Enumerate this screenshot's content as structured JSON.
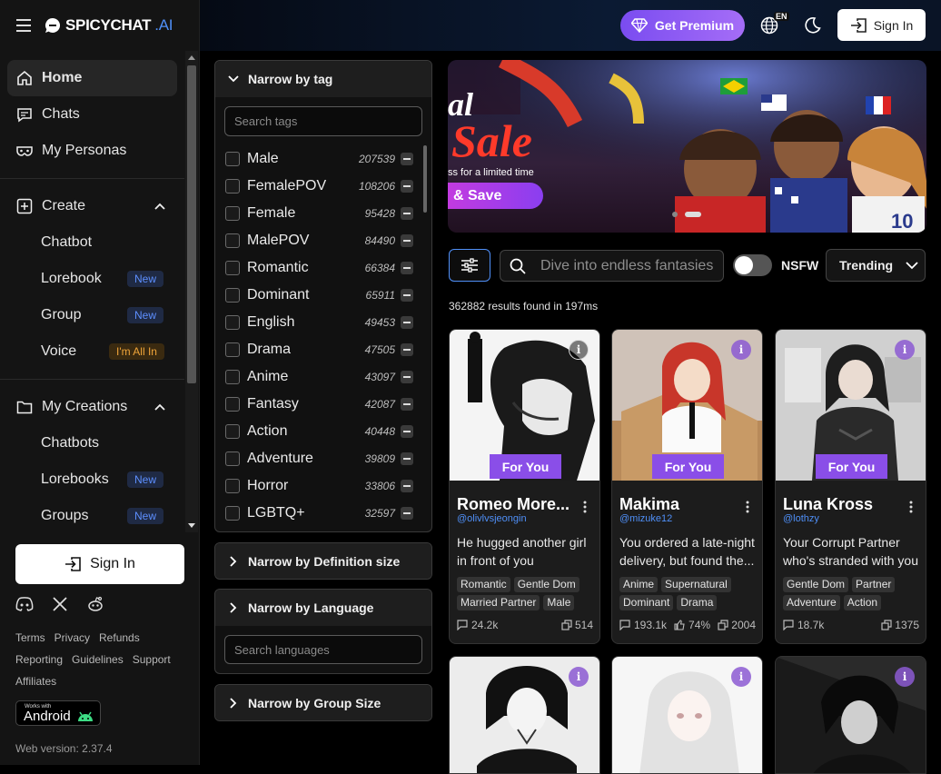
{
  "brand": {
    "name": "SPICYCHAT",
    "suffix": ".AI"
  },
  "topbar": {
    "premium_label": "Get Premium",
    "lang_badge": "EN",
    "signin_label": "Sign In"
  },
  "sidebar": {
    "items": [
      {
        "label": "Home"
      },
      {
        "label": "Chats"
      },
      {
        "label": "My Personas"
      }
    ],
    "create": {
      "label": "Create",
      "children": [
        {
          "label": "Chatbot",
          "badge": ""
        },
        {
          "label": "Lorebook",
          "badge": "New"
        },
        {
          "label": "Group",
          "badge": "New"
        },
        {
          "label": "Voice",
          "badge": "I'm All In"
        }
      ]
    },
    "creations": {
      "label": "My Creations",
      "children": [
        {
          "label": "Chatbots",
          "badge": ""
        },
        {
          "label": "Lorebooks",
          "badge": "New"
        },
        {
          "label": "Groups",
          "badge": "New"
        }
      ]
    },
    "signin_label": "Sign In",
    "footer_links": [
      "Terms",
      "Privacy",
      "Refunds",
      "Reporting",
      "Guidelines",
      "Support",
      "Affiliates"
    ],
    "android_small": "Works with",
    "android_label": "Android",
    "version": "Web version: 2.37.4"
  },
  "filters": {
    "tag_title": "Narrow by tag",
    "tag_placeholder": "Search tags",
    "tags": [
      {
        "name": "Male",
        "count": "207539"
      },
      {
        "name": "FemalePOV",
        "count": "108206"
      },
      {
        "name": "Female",
        "count": "95428"
      },
      {
        "name": "MalePOV",
        "count": "84490"
      },
      {
        "name": "Romantic",
        "count": "66384"
      },
      {
        "name": "Dominant",
        "count": "65911"
      },
      {
        "name": "English",
        "count": "49453"
      },
      {
        "name": "Drama",
        "count": "47505"
      },
      {
        "name": "Anime",
        "count": "43097"
      },
      {
        "name": "Fantasy",
        "count": "42087"
      },
      {
        "name": "Action",
        "count": "40448"
      },
      {
        "name": "Adventure",
        "count": "39809"
      },
      {
        "name": "Horror",
        "count": "33806"
      },
      {
        "name": "LGBTQ+",
        "count": "32597"
      }
    ],
    "definition_title": "Narrow by Definition size",
    "language_title": "Narrow by Language",
    "language_placeholder": "Search languages",
    "group_title": "Narrow by Group Size"
  },
  "banner": {
    "text_top": "al",
    "text_sale": "Sale",
    "text_sub": "ss for a limited time",
    "text_save": "& Save"
  },
  "toolbar": {
    "search_placeholder": "Dive into endless fantasies",
    "nsfw_label": "NSFW",
    "nsfw_on": false,
    "sort_label": "Trending"
  },
  "results_text": "362882 results found in 197ms",
  "cards": [
    {
      "for_you": "For You",
      "name": "Romeo More...",
      "handle": "@olivlvsjeongin",
      "desc": "He hugged another girl in front of you",
      "tags": [
        "Romantic",
        "Gentle Dom",
        "Married Partner",
        "Male"
      ],
      "chats": "24.2k",
      "rating": "",
      "copies": "514"
    },
    {
      "for_you": "For You",
      "name": "Makima",
      "handle": "@mizuke12",
      "desc": "You ordered a late-night delivery, but found the...",
      "tags": [
        "Anime",
        "Supernatural",
        "Dominant",
        "Drama"
      ],
      "chats": "193.1k",
      "rating": "74%",
      "copies": "2004"
    },
    {
      "for_you": "For You",
      "name": "Luna Kross",
      "handle": "@lothzy",
      "desc": "Your Corrupt Partner who's stranded with you",
      "tags": [
        "Gentle Dom",
        "Partner",
        "Adventure",
        "Action"
      ],
      "chats": "18.7k",
      "rating": "",
      "copies": "1375"
    }
  ],
  "colors": {
    "accent": "#4f8ff7",
    "for_you": "#8a4ee8",
    "premium_start": "#7a4cf0",
    "premium_end": "#a56df7"
  }
}
